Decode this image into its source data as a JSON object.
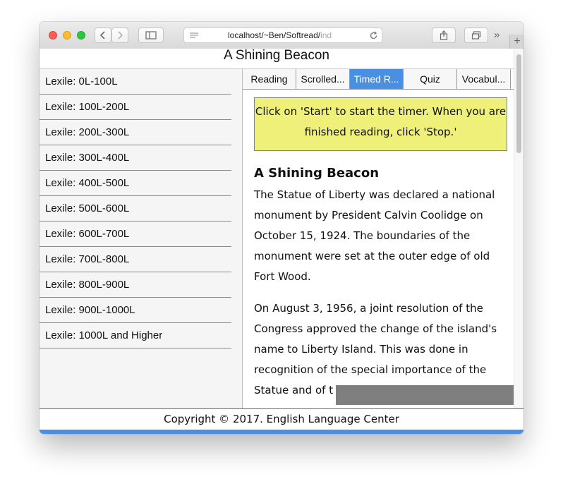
{
  "browser": {
    "url_main": "localhost/~Ben/Softread/",
    "url_faded": "ind",
    "more_glyph": "»",
    "newtab_glyph": "+"
  },
  "page": {
    "title": "A Shining Beacon"
  },
  "sidebar": {
    "items": [
      {
        "label": "Lexile: 0L-100L"
      },
      {
        "label": "Lexile: 100L-200L"
      },
      {
        "label": "Lexile: 200L-300L"
      },
      {
        "label": "Lexile: 300L-400L"
      },
      {
        "label": "Lexile: 400L-500L"
      },
      {
        "label": "Lexile: 500L-600L"
      },
      {
        "label": "Lexile: 600L-700L"
      },
      {
        "label": "Lexile: 700L-800L"
      },
      {
        "label": "Lexile: 800L-900L"
      },
      {
        "label": "Lexile: 900L-1000L"
      },
      {
        "label": "Lexile: 1000L and Higher"
      }
    ]
  },
  "tabs": [
    {
      "label": "Reading"
    },
    {
      "label": "Scrolled..."
    },
    {
      "label": "Timed R..."
    },
    {
      "label": "Quiz"
    },
    {
      "label": "Vocabul..."
    }
  ],
  "active_tab": 2,
  "notice": "Click on 'Start' to start the timer. When you are finished reading, click 'Stop.'",
  "article": {
    "title": "A Shining Beacon",
    "paragraphs": [
      "The Statue of Liberty was declared a national monument by President Calvin Coolidge on October 15, 1924. The boundaries of the monument were set at the outer edge of old Fort Wood.",
      "On August 3, 1956, a joint resolution of the Congress approved the change of the island's name to Liberty Island. This was done in recognition of the special importance of the Statue and of t"
    ]
  },
  "footer": "Copyright © 2017. English Language Center",
  "colors": {
    "active_tab": "#4a90e2",
    "notice_bg": "#eef07a",
    "footer_bar": "#4a90e2"
  }
}
